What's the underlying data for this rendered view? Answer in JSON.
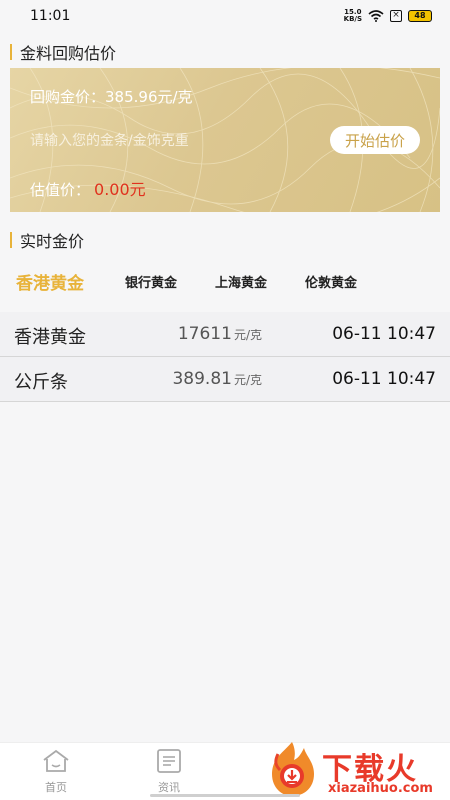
{
  "status_bar": {
    "time": "11:01",
    "net_speed_value": "15.0",
    "net_speed_unit": "KB/S",
    "battery": "48"
  },
  "buyback": {
    "section_title": "金料回购估价",
    "price_label": "回购金价：",
    "price_value": "385.96元/克",
    "input_placeholder": "请输入您的金条/金饰克重",
    "start_button": "开始估价",
    "estimate_label": "估值价：",
    "estimate_value": "0.00元"
  },
  "realtime": {
    "section_title": "实时金价",
    "tabs": [
      {
        "label": "香港黄金",
        "active": true
      },
      {
        "label": "银行黄金",
        "active": false
      },
      {
        "label": "上海黄金",
        "active": false
      },
      {
        "label": "伦敦黄金",
        "active": false
      }
    ],
    "rows": [
      {
        "name": "香港黄金",
        "price": "17611",
        "unit": "元/克",
        "time": "06-11 10:47"
      },
      {
        "name": "公斤条",
        "price": "389.81",
        "unit": "元/克",
        "time": "06-11 10:47"
      }
    ]
  },
  "bottom_nav": {
    "items": [
      {
        "label": "首页",
        "icon": "home-icon"
      },
      {
        "label": "资讯",
        "icon": "news-icon"
      }
    ]
  },
  "watermark": {
    "title": "下载火",
    "subtitle": "xiazaihuo.com"
  },
  "colors": {
    "accent": "#e8b33a",
    "card_gold": "#dcc791",
    "estimate_red": "#e0321e"
  }
}
